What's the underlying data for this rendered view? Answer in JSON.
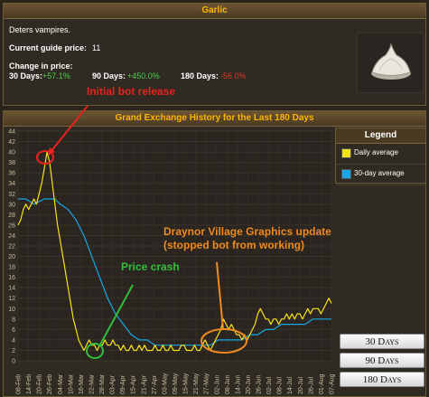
{
  "item": {
    "title": "Garlic",
    "description": "Deters vampires.",
    "price_label": "Current guide price:",
    "price_value": "11",
    "change_label": "Change in price:",
    "change30_label": "30 Days:",
    "change30_value": "+57.1%",
    "change90_label": "90 Days:",
    "change90_value": "+450.0%",
    "change180_label": "180 Days:",
    "change180_value": "-56.0%",
    "icon": "garlic-icon"
  },
  "history": {
    "title": "Grand Exchange History for the Last 180 Days",
    "legend_title": "Legend",
    "legend": [
      {
        "label": "Daily average",
        "color": "#f6e21a"
      },
      {
        "label": "30-day average",
        "color": "#1aa6e4"
      }
    ],
    "buttons": [
      "30 Days",
      "90 Days",
      "180 Days"
    ]
  },
  "annotations": {
    "bot_release": "Initial bot release",
    "price_crash": "Price crash",
    "graphics_update_1": "Draynor Village Graphics update",
    "graphics_update_2": "(stopped bot from working)",
    "colors": {
      "red": "#e8231f",
      "green": "#2fbf3a",
      "orange": "#f08a1e"
    }
  },
  "chart_data": {
    "type": "line",
    "ylim": [
      0,
      44
    ],
    "y_ticks": [
      0,
      2,
      4,
      6,
      8,
      10,
      12,
      14,
      16,
      18,
      20,
      22,
      24,
      26,
      28,
      30,
      32,
      34,
      36,
      38,
      40,
      42,
      44
    ],
    "x_ticks": [
      "08-Feb",
      "14-Feb",
      "20-Feb",
      "26-Feb",
      "04-Mar",
      "10-Mar",
      "16-Mar",
      "22-Mar",
      "28-Mar",
      "03-Apr",
      "09-Apr",
      "15-Apr",
      "21-Apr",
      "27-Apr",
      "03-May",
      "09-May",
      "15-May",
      "21-May",
      "27-May",
      "02-Jun",
      "08-Jun",
      "14-Jun",
      "20-Jun",
      "26-Jun",
      "02-Jul",
      "08-Jul",
      "14-Jul",
      "20-Jul",
      "26-Jul",
      "01-Aug",
      "07-Aug"
    ],
    "series": [
      {
        "name": "Daily average",
        "color": "#f6e21a",
        "points": [
          [
            0,
            26
          ],
          [
            1,
            27
          ],
          [
            2,
            29
          ],
          [
            3,
            30
          ],
          [
            4,
            29
          ],
          [
            5,
            30
          ],
          [
            6,
            31
          ],
          [
            7,
            30
          ],
          [
            8,
            32
          ],
          [
            9,
            34
          ],
          [
            10,
            37
          ],
          [
            11,
            40
          ],
          [
            12,
            38
          ],
          [
            13,
            34
          ],
          [
            14,
            30
          ],
          [
            15,
            26
          ],
          [
            16,
            23
          ],
          [
            17,
            20
          ],
          [
            18,
            17
          ],
          [
            19,
            14
          ],
          [
            20,
            11
          ],
          [
            21,
            8
          ],
          [
            22,
            6
          ],
          [
            23,
            4
          ],
          [
            24,
            3
          ],
          [
            25,
            2
          ],
          [
            26,
            3
          ],
          [
            27,
            4
          ],
          [
            28,
            3
          ],
          [
            29,
            3
          ],
          [
            30,
            2
          ],
          [
            31,
            3
          ],
          [
            32,
            3
          ],
          [
            33,
            4
          ],
          [
            34,
            3
          ],
          [
            35,
            3
          ],
          [
            36,
            4
          ],
          [
            37,
            3
          ],
          [
            38,
            3
          ],
          [
            39,
            2
          ],
          [
            40,
            3
          ],
          [
            41,
            2
          ],
          [
            42,
            2
          ],
          [
            43,
            3
          ],
          [
            44,
            2
          ],
          [
            45,
            2
          ],
          [
            46,
            3
          ],
          [
            47,
            2
          ],
          [
            48,
            3
          ],
          [
            49,
            2
          ],
          [
            50,
            2
          ],
          [
            51,
            2
          ],
          [
            52,
            3
          ],
          [
            53,
            2
          ],
          [
            54,
            2
          ],
          [
            55,
            3
          ],
          [
            56,
            2
          ],
          [
            57,
            2
          ],
          [
            58,
            3
          ],
          [
            59,
            2
          ],
          [
            60,
            2
          ],
          [
            61,
            2
          ],
          [
            62,
            3
          ],
          [
            63,
            3
          ],
          [
            64,
            2
          ],
          [
            65,
            2
          ],
          [
            66,
            2
          ],
          [
            67,
            3
          ],
          [
            68,
            2
          ],
          [
            69,
            2
          ],
          [
            70,
            3
          ],
          [
            71,
            4
          ],
          [
            72,
            3
          ],
          [
            73,
            2
          ],
          [
            74,
            3
          ],
          [
            75,
            4
          ],
          [
            76,
            5
          ],
          [
            77,
            6
          ],
          [
            78,
            8
          ],
          [
            79,
            7
          ],
          [
            80,
            6
          ],
          [
            81,
            7
          ],
          [
            82,
            6
          ],
          [
            83,
            5
          ],
          [
            84,
            5
          ],
          [
            85,
            4
          ],
          [
            86,
            5
          ],
          [
            87,
            4
          ],
          [
            88,
            5
          ],
          [
            89,
            6
          ],
          [
            90,
            7
          ],
          [
            91,
            9
          ],
          [
            92,
            10
          ],
          [
            93,
            9
          ],
          [
            94,
            8
          ],
          [
            95,
            8
          ],
          [
            96,
            7
          ],
          [
            97,
            8
          ],
          [
            98,
            8
          ],
          [
            99,
            7
          ],
          [
            100,
            8
          ],
          [
            101,
            8
          ],
          [
            102,
            9
          ],
          [
            103,
            8
          ],
          [
            104,
            9
          ],
          [
            105,
            8
          ],
          [
            106,
            9
          ],
          [
            107,
            9
          ],
          [
            108,
            8
          ],
          [
            109,
            9
          ],
          [
            110,
            10
          ],
          [
            111,
            9
          ],
          [
            112,
            10
          ],
          [
            113,
            10
          ],
          [
            114,
            10
          ],
          [
            115,
            9
          ],
          [
            116,
            10
          ],
          [
            117,
            11
          ],
          [
            118,
            12
          ],
          [
            119,
            11
          ]
        ]
      },
      {
        "name": "30-day average",
        "color": "#1aa6e4",
        "points": [
          [
            0,
            31
          ],
          [
            3,
            31
          ],
          [
            6,
            30
          ],
          [
            10,
            31
          ],
          [
            14,
            31
          ],
          [
            16,
            30
          ],
          [
            19,
            29
          ],
          [
            22,
            27
          ],
          [
            25,
            24
          ],
          [
            28,
            20
          ],
          [
            31,
            16
          ],
          [
            34,
            12
          ],
          [
            37,
            9
          ],
          [
            40,
            7
          ],
          [
            43,
            5
          ],
          [
            46,
            4
          ],
          [
            49,
            4
          ],
          [
            52,
            3
          ],
          [
            55,
            3
          ],
          [
            58,
            3
          ],
          [
            61,
            3
          ],
          [
            64,
            3
          ],
          [
            67,
            3
          ],
          [
            70,
            3
          ],
          [
            73,
            3
          ],
          [
            76,
            4
          ],
          [
            79,
            4
          ],
          [
            82,
            4
          ],
          [
            85,
            4
          ],
          [
            88,
            5
          ],
          [
            91,
            5
          ],
          [
            94,
            6
          ],
          [
            97,
            6
          ],
          [
            100,
            7
          ],
          [
            103,
            7
          ],
          [
            106,
            7
          ],
          [
            109,
            7
          ],
          [
            112,
            8
          ],
          [
            115,
            8
          ],
          [
            119,
            8
          ]
        ]
      }
    ]
  }
}
